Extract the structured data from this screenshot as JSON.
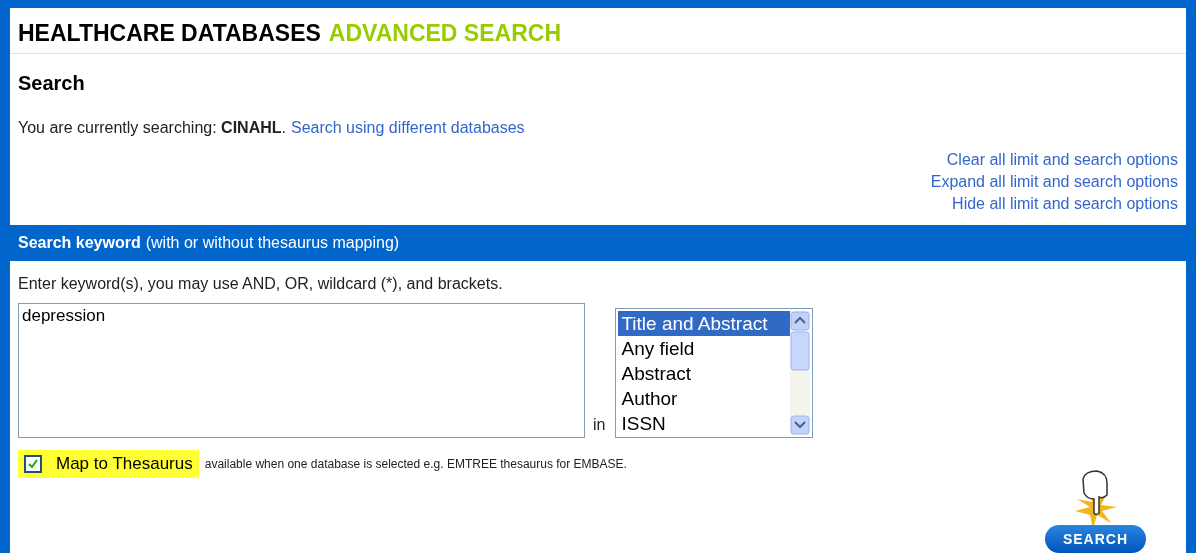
{
  "header": {
    "title": "HEALTHCARE DATABASES",
    "subtitle": "ADVANCED SEARCH"
  },
  "search_section": {
    "heading": "Search",
    "current": "You are currently searching: **CINAHL**.",
    "change_link": "Search using different databases",
    "option_links": [
      "Clear all limit and search options",
      "Expand all limit and search options",
      "Hide all limit and search options"
    ]
  },
  "keyword_section": {
    "bar_title": "Search keyword",
    "bar_note": "(with or without thesaurus mapping)",
    "instructions": "Enter keyword(s), you may use AND, OR, wildcard (*), and brackets.",
    "keyword_value": "depression",
    "in_label": "in",
    "fields": [
      {
        "label": "Title and Abstract",
        "selected": true
      },
      {
        "label": "Any field",
        "selected": false
      },
      {
        "label": "Abstract",
        "selected": false
      },
      {
        "label": "Author",
        "selected": false
      },
      {
        "label": "ISSN",
        "selected": false
      }
    ],
    "map_to_thesaurus": {
      "label": "Map to Thesaurus",
      "checked": true,
      "note": "available when one database is selected e.g. EMTREE thesaurus for EMBASE."
    },
    "search_button": "SEARCH"
  }
}
